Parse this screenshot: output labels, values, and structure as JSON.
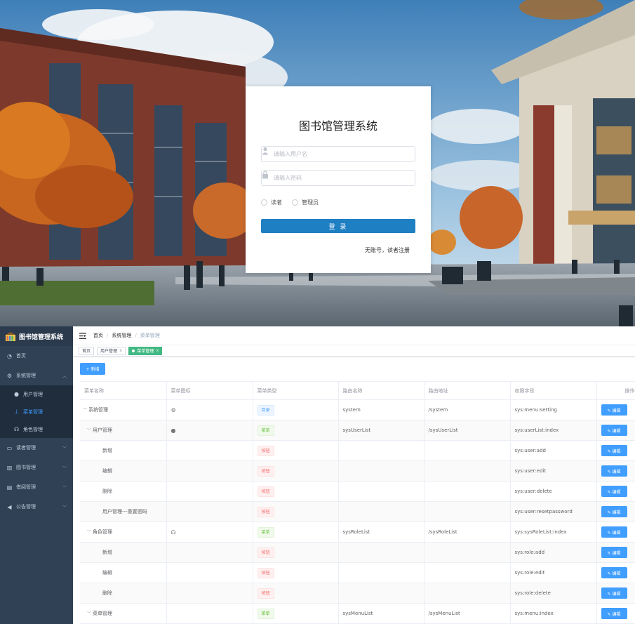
{
  "login": {
    "title": "图书馆管理系统",
    "username_placeholder": "请输入用户名",
    "password_placeholder": "请输入密码",
    "roles": [
      "读者",
      "管理员"
    ],
    "submit_label": "登 录",
    "register_text": "无账号，读者注册",
    "accent": "#1f7fc3"
  },
  "sidebar": {
    "title": "图书馆管理系统",
    "items": [
      {
        "label": "首页",
        "icon": "dashboard-icon"
      },
      {
        "label": "系统管理",
        "icon": "gear-icon",
        "expanded": true,
        "children": [
          {
            "label": "用户管理",
            "icon": "user-icon"
          },
          {
            "label": "菜单管理",
            "icon": "tree-icon",
            "active": true
          },
          {
            "label": "角色管理",
            "icon": "peoples-icon"
          }
        ]
      },
      {
        "label": "读者管理",
        "icon": "card-icon"
      },
      {
        "label": "图书管理",
        "icon": "books-icon"
      },
      {
        "label": "借阅管理",
        "icon": "document-icon"
      },
      {
        "label": "公告管理",
        "icon": "megaphone-icon"
      }
    ],
    "background": "#304156",
    "active_color": "#409eff"
  },
  "breadcrumb": [
    "首页",
    "系统管理",
    "菜单管理"
  ],
  "tags": [
    {
      "label": "首页"
    },
    {
      "label": "用户管理"
    },
    {
      "label": "菜单管理",
      "active": true
    }
  ],
  "toolbar": {
    "add_label": "+ 新增"
  },
  "table": {
    "columns": [
      "菜单名称",
      "菜单图标",
      "菜单类型",
      "路由名称",
      "路由地址",
      "权限字段",
      "操作"
    ],
    "edit_label": "✎ 编辑",
    "rows": [
      {
        "name": "系统管理",
        "level": 0,
        "arrow": true,
        "icon": "⚙",
        "type": "目录",
        "type_kind": "dir",
        "route_name": "system",
        "route_path": "/system",
        "perm": "sys:menu:setting"
      },
      {
        "name": "用户管理",
        "level": 1,
        "arrow": true,
        "icon": "●",
        "type": "菜单",
        "type_kind": "menu",
        "route_name": "sysUserList",
        "route_path": "/sysUserList",
        "perm": "sys:userList:index"
      },
      {
        "name": "新增",
        "level": 2,
        "arrow": false,
        "icon": "",
        "type": "按钮",
        "type_kind": "btn",
        "route_name": "",
        "route_path": "",
        "perm": "sys:user:add"
      },
      {
        "name": "编辑",
        "level": 2,
        "arrow": false,
        "icon": "",
        "type": "按钮",
        "type_kind": "btn",
        "route_name": "",
        "route_path": "",
        "perm": "sys:user:edit"
      },
      {
        "name": "删除",
        "level": 2,
        "arrow": false,
        "icon": "",
        "type": "按钮",
        "type_kind": "btn",
        "route_name": "",
        "route_path": "",
        "perm": "sys:user:delete"
      },
      {
        "name": "用户管理---重置密码",
        "level": 2,
        "arrow": false,
        "icon": "",
        "type": "按钮",
        "type_kind": "btn",
        "route_name": "",
        "route_path": "",
        "perm": "sys:user:resetpassword"
      },
      {
        "name": "角色管理",
        "level": 1,
        "arrow": true,
        "icon": "☊",
        "type": "菜单",
        "type_kind": "menu",
        "route_name": "sysRoleList",
        "route_path": "/sysRoleList",
        "perm": "sys:sysRoleList:index"
      },
      {
        "name": "新增",
        "level": 2,
        "arrow": false,
        "icon": "",
        "type": "按钮",
        "type_kind": "btn",
        "route_name": "",
        "route_path": "",
        "perm": "sys:role:add"
      },
      {
        "name": "编辑",
        "level": 2,
        "arrow": false,
        "icon": "",
        "type": "按钮",
        "type_kind": "btn",
        "route_name": "",
        "route_path": "",
        "perm": "sys:role:edit"
      },
      {
        "name": "删除",
        "level": 2,
        "arrow": false,
        "icon": "",
        "type": "按钮",
        "type_kind": "btn",
        "route_name": "",
        "route_path": "",
        "perm": "sys:role:delete"
      },
      {
        "name": "菜单管理",
        "level": 1,
        "arrow": true,
        "icon": "",
        "type": "菜单",
        "type_kind": "menu",
        "route_name": "sysMenuList",
        "route_path": "/sysMenuList",
        "perm": "sys:menu:index"
      }
    ]
  }
}
